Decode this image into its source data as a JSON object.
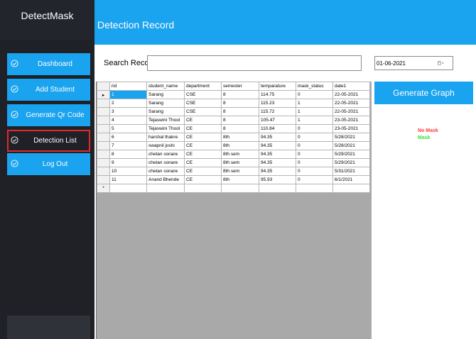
{
  "app": {
    "brand": "DetectMask"
  },
  "sidebar": {
    "items": [
      {
        "label": "Dashboard"
      },
      {
        "label": "Add Student"
      },
      {
        "label": "Generate Qr Code"
      },
      {
        "label": "Detection List"
      },
      {
        "label": "Log Out"
      }
    ]
  },
  "header": {
    "title": "Detection Record"
  },
  "search": {
    "label": "Search Record",
    "value": ""
  },
  "datepicker": {
    "value": "01-06-2021"
  },
  "graph": {
    "button_label": "Generate Graph",
    "legend_no_mask": "No Mask",
    "legend_mask": "Mask",
    "no_mask_color": "#ff3b3b",
    "mask_color": "#3be03b"
  },
  "colors": {
    "accent": "#1aa3ef",
    "sidebar_bg": "#1f2127",
    "active_border": "#e12b2b"
  },
  "table": {
    "columns": [
      "rid",
      "student_name",
      "department",
      "semester",
      "temparature",
      "mask_status",
      "date1"
    ],
    "rows": [
      [
        "1",
        "Sarang",
        "CSE",
        "8",
        "114.75",
        "0",
        "22-05-2021"
      ],
      [
        "2",
        "Sarang",
        "CSE",
        "8",
        "115.23",
        "1",
        "22-05-2021"
      ],
      [
        "3",
        "Sarang",
        "CSE",
        "8",
        "115.72",
        "1",
        "22-05-2021"
      ],
      [
        "4",
        "Tejaswini Thool",
        "CE",
        "8",
        "105.47",
        "1",
        "23-05-2021"
      ],
      [
        "5",
        "Tejaswini Thool",
        "CE",
        "8",
        "110.84",
        "0",
        "23-05-2021"
      ],
      [
        "6",
        "harshal thakre",
        "CE",
        "8th",
        "94.35",
        "0",
        "5/28/2021"
      ],
      [
        "7",
        "swapnil joshi",
        "CE",
        "8th",
        "94.35",
        "0",
        "5/28/2021"
      ],
      [
        "8",
        "chetan sonare",
        "CE",
        "8th sem",
        "94.35",
        "0",
        "5/29/2021"
      ],
      [
        "9",
        "chetan sonare",
        "CE",
        "8th sem",
        "94.35",
        "0",
        "5/29/2021"
      ],
      [
        "10",
        "chetan sonare",
        "CE",
        "8th sem",
        "94.35",
        "0",
        "5/31/2021"
      ],
      [
        "11",
        "Anand Bhende",
        "CE",
        "8th",
        "95.93",
        "0",
        "6/1/2021"
      ]
    ],
    "current_row_marker": "▸",
    "new_row_marker": "*"
  }
}
